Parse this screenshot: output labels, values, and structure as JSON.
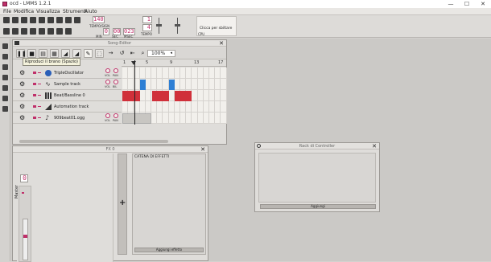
{
  "window": {
    "title": "ocd - LMMS 1.2.1",
    "minimize": "—",
    "maximize": "☐",
    "close": "✕"
  },
  "menu": [
    "File",
    "Modifica",
    "Visualizza",
    "Strumenti",
    "Aiuto"
  ],
  "toolbar": {
    "tempo_sig_label": "TEMPO/SIGN",
    "tempo_sig_top": "1",
    "tempo_sig_bottom": "4",
    "time": {
      "min": "0",
      "sec": "00",
      "msec": "023",
      "min_label": "MIN",
      "sec_label": "SEC",
      "msec_label": "MSEC"
    },
    "tempo_value": "140",
    "tempo_label": "TEMPO",
    "cpu_hint": "Clicca per sbiltare",
    "cpu_label": "CPU"
  },
  "song_editor": {
    "title": "Song-Editor",
    "tooltip": "Riproduci il brano (Spazio)",
    "zoom": "100%",
    "bar_numbers": [
      "1",
      "5",
      "9",
      "13",
      "17"
    ],
    "tracks": [
      {
        "name": "TripleOscillator",
        "icon": "oscillator-icon",
        "vol_label": "VOL",
        "pan_label": "PAN"
      },
      {
        "name": "Sample track",
        "icon": "waveform-icon",
        "vol_label": "VOL",
        "pan_label": "BIL"
      },
      {
        "name": "Beat/Bassline 0",
        "icon": "beat-bassline-icon",
        "vol_label": "",
        "pan_label": ""
      },
      {
        "name": "Automation track",
        "icon": "automation-icon",
        "vol_label": "",
        "pan_label": ""
      },
      {
        "name": "909beat01.ogg",
        "icon": "note-icon",
        "vol_label": "VOL",
        "pan_label": "PAN"
      }
    ]
  },
  "fx_mixer": {
    "title": "FX 0",
    "channel_name": "Master",
    "channel_number": "0",
    "effects_chain_label": "CATENA DI EFFETTI",
    "add_effect_label": "Aggiungi effetto",
    "add_channel_symbol": "+"
  },
  "controller_rack": {
    "title": "Rack di Controller",
    "add_label": "Aggiungi"
  },
  "colors": {
    "accent": "#c0306a",
    "beat_red": "#d0303a",
    "sample_blue": "#2e7fd4"
  }
}
